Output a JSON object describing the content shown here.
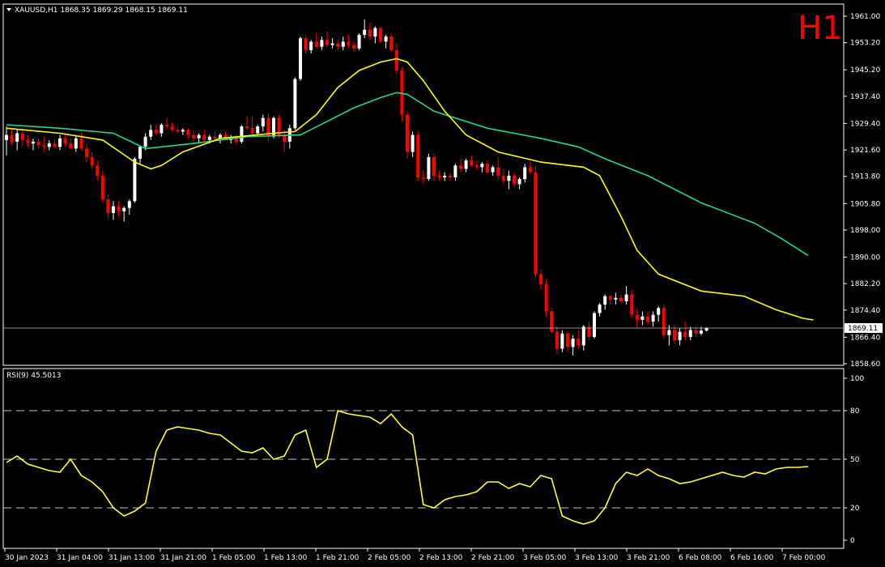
{
  "header": {
    "info": "XAUUSD,H1  1868.35 1869.29 1868.15 1869.11",
    "timeframe": "H1",
    "rsi_info": "RSI(9) 45.5013"
  },
  "colors": {
    "background": "#000000",
    "frame": "#ffffff",
    "bull": "#ffffff",
    "bear": "#ff0000",
    "ma_fast": "#ffff00",
    "ma_slow": "#1ed68c",
    "rsi": "#ffff33",
    "grid_dash": "#c8c8c8",
    "timeframe": "#ff0000"
  },
  "icons": {
    "menu": "triangle-down-icon"
  },
  "chart_data": [
    {
      "type": "candlestick",
      "symbol": "XAUUSD",
      "timeframe": "H1",
      "ylim": [
        1857.0,
        1963.5
      ],
      "last_price": 1869.11,
      "last_price_label": "1869.11",
      "yticks": [
        "1961.00",
        "1953.20",
        "1945.20",
        "1937.40",
        "1929.40",
        "1921.60",
        "1913.80",
        "1905.80",
        "1898.00",
        "1890.00",
        "1882.20",
        "1874.40",
        "1866.40",
        "1858.60"
      ],
      "candles": [
        [
          1924.5,
          1928.5,
          1920.0,
          1926.0
        ],
        [
          1926.0,
          1928.0,
          1923.0,
          1924.0
        ],
        [
          1924.0,
          1927.5,
          1921.5,
          1926.5
        ],
        [
          1926.5,
          1928.0,
          1922.5,
          1924.5
        ],
        [
          1924.5,
          1926.0,
          1922.5,
          1923.5
        ],
        [
          1923.5,
          1925.0,
          1921.5,
          1924.0
        ],
        [
          1924.0,
          1925.0,
          1922.0,
          1923.0
        ],
        [
          1923.0,
          1925.5,
          1921.0,
          1922.5
        ],
        [
          1922.5,
          1924.5,
          1921.5,
          1923.5
        ],
        [
          1923.5,
          1925.0,
          1922.0,
          1922.5
        ],
        [
          1922.5,
          1926.0,
          1921.5,
          1925.0
        ],
        [
          1925.0,
          1926.5,
          1922.5,
          1923.5
        ],
        [
          1923.5,
          1925.0,
          1922.0,
          1922.0
        ],
        [
          1922.0,
          1926.0,
          1921.0,
          1925.0
        ],
        [
          1925.0,
          1926.5,
          1921.5,
          1922.0
        ],
        [
          1922.0,
          1923.5,
          1918.0,
          1919.5
        ],
        [
          1919.5,
          1921.0,
          1916.0,
          1917.0
        ],
        [
          1917.0,
          1918.5,
          1912.5,
          1914.0
        ],
        [
          1914.0,
          1915.5,
          1906.0,
          1907.0
        ],
        [
          1907.0,
          1908.5,
          1901.5,
          1903.0
        ],
        [
          1903.0,
          1906.5,
          1901.0,
          1905.0
        ],
        [
          1905.0,
          1906.5,
          1902.0,
          1903.5
        ],
        [
          1903.5,
          1905.0,
          1900.5,
          1904.5
        ],
        [
          1904.5,
          1907.0,
          1902.5,
          1906.5
        ],
        [
          1906.5,
          1919.5,
          1906.0,
          1919.0
        ],
        [
          1919.0,
          1923.0,
          1917.5,
          1922.5
        ],
        [
          1922.5,
          1926.5,
          1921.5,
          1925.5
        ],
        [
          1925.5,
          1929.0,
          1924.5,
          1927.5
        ],
        [
          1927.5,
          1929.0,
          1926.0,
          1926.5
        ],
        [
          1926.5,
          1929.5,
          1925.5,
          1929.0
        ],
        [
          1929.0,
          1931.0,
          1927.5,
          1928.5
        ],
        [
          1928.5,
          1929.5,
          1927.0,
          1927.5
        ],
        [
          1927.5,
          1928.5,
          1926.5,
          1927.0
        ],
        [
          1927.0,
          1928.0,
          1926.0,
          1927.5
        ],
        [
          1927.5,
          1928.0,
          1925.0,
          1926.0
        ],
        [
          1926.0,
          1927.5,
          1924.0,
          1925.0
        ],
        [
          1925.0,
          1926.5,
          1923.5,
          1926.0
        ],
        [
          1926.0,
          1927.5,
          1924.0,
          1924.5
        ],
        [
          1924.5,
          1926.0,
          1923.5,
          1925.5
        ],
        [
          1925.5,
          1927.0,
          1924.5,
          1925.0
        ],
        [
          1925.0,
          1926.5,
          1923.5,
          1926.0
        ],
        [
          1926.0,
          1927.0,
          1924.5,
          1924.5
        ],
        [
          1924.5,
          1926.0,
          1923.5,
          1925.0
        ],
        [
          1925.0,
          1926.0,
          1923.0,
          1924.0
        ],
        [
          1924.0,
          1929.0,
          1923.5,
          1928.5
        ],
        [
          1928.5,
          1931.5,
          1927.5,
          1928.0
        ],
        [
          1928.0,
          1931.5,
          1926.0,
          1926.5
        ],
        [
          1926.5,
          1929.0,
          1925.5,
          1928.5
        ],
        [
          1928.5,
          1932.0,
          1927.0,
          1931.0
        ],
        [
          1931.0,
          1932.5,
          1924.0,
          1925.5
        ],
        [
          1925.5,
          1931.5,
          1925.0,
          1931.0
        ],
        [
          1931.0,
          1932.0,
          1925.0,
          1926.0
        ],
        [
          1926.0,
          1927.5,
          1921.0,
          1924.0
        ],
        [
          1924.0,
          1929.0,
          1922.0,
          1928.0
        ],
        [
          1928.0,
          1943.0,
          1927.5,
          1942.5
        ],
        [
          1942.5,
          1955.0,
          1942.0,
          1954.5
        ],
        [
          1954.5,
          1955.5,
          1950.0,
          1951.0
        ],
        [
          1951.0,
          1954.0,
          1950.0,
          1953.5
        ],
        [
          1953.5,
          1956.0,
          1951.5,
          1952.0
        ],
        [
          1952.0,
          1955.0,
          1951.0,
          1954.0
        ],
        [
          1954.0,
          1956.5,
          1952.0,
          1952.5
        ],
        [
          1952.5,
          1954.5,
          1951.5,
          1953.0
        ],
        [
          1953.0,
          1954.0,
          1951.0,
          1952.0
        ],
        [
          1952.0,
          1955.0,
          1951.0,
          1953.5
        ],
        [
          1953.5,
          1955.5,
          1951.5,
          1952.5
        ],
        [
          1952.5,
          1953.5,
          1950.5,
          1951.5
        ],
        [
          1951.5,
          1956.0,
          1951.0,
          1955.5
        ],
        [
          1955.5,
          1960.0,
          1954.5,
          1957.0
        ],
        [
          1957.0,
          1959.0,
          1954.0,
          1955.0
        ],
        [
          1955.0,
          1958.0,
          1953.0,
          1957.5
        ],
        [
          1957.5,
          1958.0,
          1953.0,
          1953.5
        ],
        [
          1953.5,
          1955.5,
          1951.5,
          1955.0
        ],
        [
          1955.0,
          1956.0,
          1950.5,
          1951.0
        ],
        [
          1951.0,
          1953.0,
          1944.0,
          1945.0
        ],
        [
          1945.0,
          1946.0,
          1930.0,
          1932.0
        ],
        [
          1932.0,
          1933.0,
          1919.0,
          1921.0
        ],
        [
          1921.0,
          1927.0,
          1919.5,
          1926.0
        ],
        [
          1926.0,
          1927.0,
          1912.5,
          1913.5
        ],
        [
          1913.5,
          1915.5,
          1911.5,
          1913.0
        ],
        [
          1913.0,
          1920.5,
          1912.5,
          1919.5
        ],
        [
          1919.5,
          1920.5,
          1912.5,
          1914.0
        ],
        [
          1914.0,
          1915.5,
          1912.5,
          1913.5
        ],
        [
          1913.5,
          1915.0,
          1912.5,
          1914.0
        ],
        [
          1914.0,
          1915.0,
          1912.5,
          1913.5
        ],
        [
          1913.5,
          1917.5,
          1912.5,
          1917.0
        ],
        [
          1917.0,
          1919.0,
          1915.0,
          1916.0
        ],
        [
          1916.0,
          1919.0,
          1915.0,
          1918.5
        ],
        [
          1918.5,
          1920.0,
          1916.5,
          1917.0
        ],
        [
          1917.0,
          1918.5,
          1915.5,
          1916.5
        ],
        [
          1916.5,
          1918.0,
          1915.0,
          1917.5
        ],
        [
          1917.5,
          1918.5,
          1914.5,
          1915.0
        ],
        [
          1915.0,
          1917.0,
          1914.0,
          1916.5
        ],
        [
          1916.5,
          1919.5,
          1913.0,
          1914.0
        ],
        [
          1914.0,
          1916.0,
          1911.5,
          1912.5
        ],
        [
          1912.5,
          1915.5,
          1910.0,
          1914.0
        ],
        [
          1914.0,
          1915.0,
          1910.5,
          1911.5
        ],
        [
          1911.5,
          1913.5,
          1910.0,
          1913.0
        ],
        [
          1913.0,
          1917.5,
          1912.0,
          1916.5
        ],
        [
          1916.5,
          1918.0,
          1914.5,
          1915.0
        ],
        [
          1915.0,
          1917.0,
          1884.0,
          1885.0
        ],
        [
          1885.0,
          1886.5,
          1880.5,
          1882.0
        ],
        [
          1882.0,
          1883.5,
          1872.5,
          1874.0
        ],
        [
          1874.0,
          1875.0,
          1867.5,
          1868.0
        ],
        [
          1868.0,
          1869.5,
          1861.5,
          1863.0
        ],
        [
          1863.0,
          1868.5,
          1862.0,
          1867.5
        ],
        [
          1867.5,
          1868.0,
          1862.0,
          1863.5
        ],
        [
          1863.5,
          1867.0,
          1861.0,
          1866.0
        ],
        [
          1866.0,
          1868.5,
          1863.0,
          1864.0
        ],
        [
          1864.0,
          1870.0,
          1862.5,
          1869.5
        ],
        [
          1869.5,
          1871.0,
          1865.5,
          1866.5
        ],
        [
          1866.5,
          1874.0,
          1866.0,
          1873.5
        ],
        [
          1873.5,
          1876.5,
          1872.5,
          1876.0
        ],
        [
          1876.0,
          1879.0,
          1874.5,
          1878.5
        ],
        [
          1878.5,
          1879.0,
          1876.0,
          1877.5
        ],
        [
          1877.5,
          1879.5,
          1876.0,
          1878.0
        ],
        [
          1878.0,
          1879.0,
          1876.5,
          1877.0
        ],
        [
          1877.0,
          1881.5,
          1876.0,
          1879.0
        ],
        [
          1879.0,
          1880.5,
          1872.0,
          1873.0
        ],
        [
          1873.0,
          1875.0,
          1869.0,
          1871.5
        ],
        [
          1871.5,
          1874.0,
          1870.0,
          1872.5
        ],
        [
          1872.5,
          1874.0,
          1870.0,
          1871.0
        ],
        [
          1871.0,
          1874.0,
          1869.5,
          1873.0
        ],
        [
          1873.0,
          1875.5,
          1871.0,
          1875.0
        ],
        [
          1875.0,
          1876.0,
          1866.0,
          1867.0
        ],
        [
          1867.0,
          1870.0,
          1864.0,
          1868.5
        ],
        [
          1868.5,
          1870.0,
          1864.5,
          1865.5
        ],
        [
          1865.5,
          1869.0,
          1864.0,
          1868.0
        ],
        [
          1868.0,
          1871.0,
          1865.5,
          1866.5
        ],
        [
          1866.5,
          1869.5,
          1865.5,
          1868.5
        ],
        [
          1868.5,
          1869.5,
          1866.5,
          1867.5
        ],
        [
          1867.5,
          1869.5,
          1867.0,
          1868.35
        ],
        [
          1868.35,
          1869.29,
          1868.15,
          1869.11
        ]
      ],
      "ma_slow": [
        [
          0,
          1929.0
        ],
        [
          10,
          1928.0
        ],
        [
          20,
          1926.5
        ],
        [
          26,
          1922.0
        ],
        [
          35,
          1923.5
        ],
        [
          45,
          1925.5
        ],
        [
          55,
          1926.0
        ],
        [
          60,
          1930.0
        ],
        [
          65,
          1934.0
        ],
        [
          70,
          1937.0
        ],
        [
          73,
          1938.5
        ],
        [
          75,
          1938.0
        ],
        [
          80,
          1933.0
        ],
        [
          90,
          1928.0
        ],
        [
          100,
          1925.0
        ],
        [
          107,
          1922.5
        ],
        [
          112,
          1919.0
        ],
        [
          120,
          1914.0
        ],
        [
          130,
          1906.0
        ],
        [
          140,
          1900.0
        ],
        [
          145,
          1895.5
        ],
        [
          150,
          1890.5
        ]
      ],
      "ma_fast": [
        [
          0,
          1928.0
        ],
        [
          10,
          1926.5
        ],
        [
          18,
          1924.5
        ],
        [
          24,
          1918.0
        ],
        [
          27,
          1916.0
        ],
        [
          29,
          1917.0
        ],
        [
          33,
          1921.0
        ],
        [
          40,
          1925.0
        ],
        [
          50,
          1926.5
        ],
        [
          54,
          1927.0
        ],
        [
          58,
          1932.0
        ],
        [
          62,
          1940.0
        ],
        [
          66,
          1945.0
        ],
        [
          70,
          1947.5
        ],
        [
          73,
          1948.5
        ],
        [
          75,
          1947.5
        ],
        [
          78,
          1942.0
        ],
        [
          82,
          1933.0
        ],
        [
          86,
          1926.0
        ],
        [
          92,
          1921.0
        ],
        [
          100,
          1918.0
        ],
        [
          108,
          1916.5
        ],
        [
          111,
          1914.0
        ],
        [
          115,
          1902.0
        ],
        [
          118,
          1892.0
        ],
        [
          122,
          1885.0
        ],
        [
          130,
          1880.0
        ],
        [
          138,
          1878.5
        ],
        [
          144,
          1874.5
        ],
        [
          149,
          1872.0
        ],
        [
          151,
          1871.5
        ]
      ]
    },
    {
      "type": "line",
      "name": "RSI(9)",
      "value_label": "45.5013",
      "ylim": [
        0,
        100
      ],
      "yticks": [
        "100",
        "80",
        "50",
        "20",
        "0"
      ],
      "levels": [
        80,
        50,
        20
      ],
      "x": [
        0,
        2,
        4,
        6,
        8,
        10,
        12,
        14,
        16,
        18,
        20,
        22,
        24,
        26,
        28,
        30,
        32,
        34,
        36,
        38,
        40,
        42,
        44,
        46,
        48,
        50,
        52,
        54,
        56,
        58,
        60,
        62,
        64,
        66,
        68,
        70,
        72,
        74,
        76,
        78,
        80,
        82,
        84,
        86,
        88,
        90,
        92,
        94,
        96,
        98,
        100,
        102,
        104,
        106,
        108,
        110,
        112,
        114,
        116,
        118,
        120,
        122,
        124,
        126,
        128,
        130,
        132,
        134,
        136,
        138,
        140,
        142,
        144,
        146,
        148,
        150
      ],
      "values": [
        48,
        52,
        47,
        45,
        43,
        42,
        50,
        40,
        36,
        30,
        20,
        15,
        18,
        23,
        55,
        68,
        70,
        69,
        68,
        66,
        65,
        60,
        55,
        54,
        57,
        50,
        52,
        65,
        68,
        45,
        50,
        80,
        78,
        77,
        76,
        72,
        78,
        70,
        65,
        22,
        20,
        25,
        27,
        28,
        30,
        36,
        36,
        32,
        35,
        33,
        40,
        38,
        15,
        12,
        10,
        12,
        20,
        35,
        42,
        40,
        44,
        40,
        38,
        35,
        36,
        38,
        40,
        42,
        40,
        39,
        42,
        41,
        44,
        45,
        45,
        45.5
      ],
      "x_labels": [
        "30 Jan 2023",
        "31 Jan 04:00",
        "31 Jan 13:00",
        "31 Jan 21:00",
        "1 Feb 05:00",
        "1 Feb 13:00",
        "1 Feb 21:00",
        "2 Feb 05:00",
        "2 Feb 13:00",
        "2 Feb 21:00",
        "3 Feb 05:00",
        "3 Feb 13:00",
        "3 Feb 21:00",
        "6 Feb 08:00",
        "6 Feb 16:00",
        "7 Feb 00:00"
      ]
    }
  ]
}
